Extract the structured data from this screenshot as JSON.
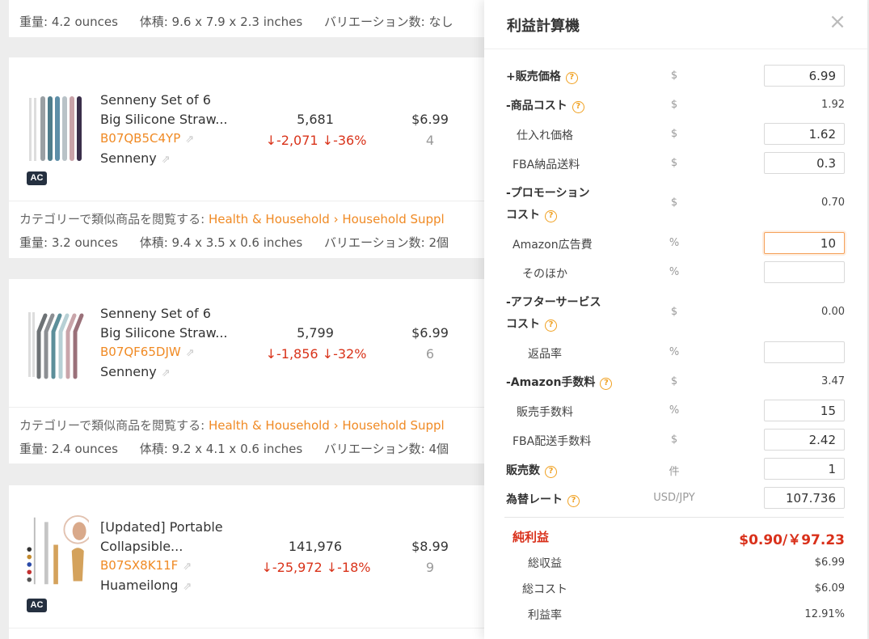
{
  "products": [
    {
      "weight": "重量: 4.2 ounces",
      "dims": "体積: 9.6 x 7.9 x 2.3 inches",
      "variations": "バリエーション数: なし"
    },
    {
      "ac_badge": "AC",
      "title_line1": "Senneny Set of 6",
      "title_line2": "Big Silicone Straw...",
      "asin": "B07QB5C4YP",
      "brand": "Senneny",
      "sales": "5,681",
      "sales_change": "↓-2,071",
      "sales_change_pct": "↓-36%",
      "price": "$6.99",
      "sellers": "4",
      "category_prefix": "カテゴリーで類似商品を閲覧する:",
      "category_path": "Health & Household › Household Suppl",
      "weight": "重量: 3.2 ounces",
      "dims": "体積: 9.4 x 3.5 x 0.6 inches",
      "variations": "バリエーション数: 2個"
    },
    {
      "title_line1": "Senneny Set of 6",
      "title_line2": "Big Silicone Straw...",
      "asin": "B07QF65DJW",
      "brand": "Senneny",
      "sales": "5,799",
      "sales_change": "↓-1,856",
      "sales_change_pct": "↓-32%",
      "price": "$6.99",
      "sellers": "6",
      "category_prefix": "カテゴリーで類似商品を閲覧する:",
      "category_path": "Health & Household › Household Suppl",
      "weight": "重量: 2.4 ounces",
      "dims": "体積: 9.2 x 4.1 x 0.6 inches",
      "variations": "バリエーション数: 4個"
    },
    {
      "ac_badge": "AC",
      "title_line1": "[Updated] Portable",
      "title_line2": "Collapsible...",
      "asin": "B07SX8K11F",
      "brand": "Huameilong",
      "sales": "141,976",
      "sales_change": "↓-25,972",
      "sales_change_pct": "↓-18%",
      "price": "$8.99",
      "sellers": "9"
    }
  ],
  "calculator": {
    "title": "利益計算機",
    "rows": [
      {
        "label": "+販売価格",
        "help": "?",
        "unit": "$",
        "input": "6.99"
      },
      {
        "label": "-商品コスト",
        "help": "?",
        "unit": "$",
        "value": "1.92"
      },
      {
        "label": "仕入れ価格",
        "unit": "$",
        "input": "1.62"
      },
      {
        "label": "FBA納品送料",
        "unit": "$",
        "input": "0.3"
      },
      {
        "label_line1": "-プロモーション",
        "label_line2": "コスト",
        "help": "?",
        "unit": "$",
        "value": "0.70"
      },
      {
        "label": "Amazon広告費",
        "unit": "%",
        "input": "10"
      },
      {
        "label": "そのほか",
        "unit": "%",
        "input": ""
      },
      {
        "label_line1": "-アフターサービス",
        "label_line2": "コスト",
        "help": "?",
        "unit": "$",
        "value": "0.00"
      },
      {
        "label": "返品率",
        "unit": "%",
        "input": ""
      },
      {
        "label": "-Amazon手数料",
        "help": "?",
        "unit": "$",
        "value": "3.47"
      },
      {
        "label": "販売手数料",
        "unit": "%",
        "input": "15"
      },
      {
        "label": "FBA配送手数料",
        "unit": "$",
        "input": "2.42"
      },
      {
        "label": "販売数",
        "help": "?",
        "unit": "件",
        "input": "1"
      },
      {
        "label": "為替レート",
        "help": "?",
        "unit": "USD/JPY",
        "input": "107.736"
      }
    ],
    "net_profit_label": "純利益",
    "net_profit_value": "$0.90/￥97.23",
    "total_revenue_label": "総収益",
    "total_revenue_value": "$6.99",
    "total_cost_label": "総コスト",
    "total_cost_value": "$6.09",
    "margin_label": "利益率",
    "margin_value": "12.91%"
  },
  "colors": {
    "accent_orange": "#f08a24",
    "down_red": "#d9331a",
    "help_icon": "#f0a020",
    "net_profit_red": "#d9301a"
  }
}
